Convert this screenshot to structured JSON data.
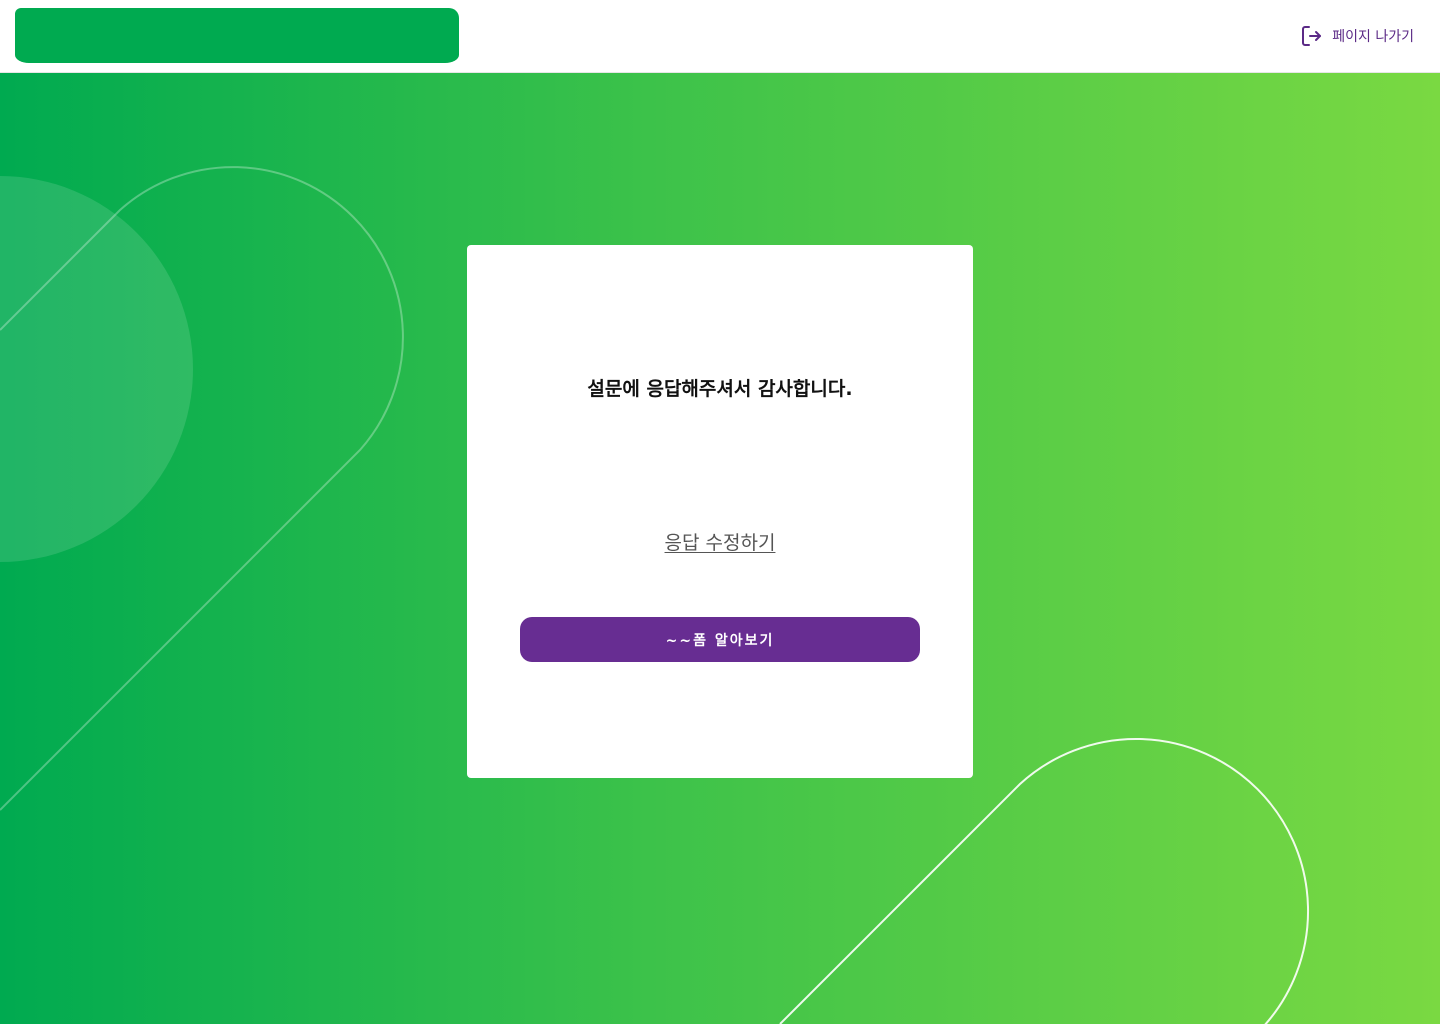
{
  "header": {
    "exit_label": "페이지 나가기",
    "exit_icon": "logout-icon",
    "logo_color": "#00aa50"
  },
  "card": {
    "title": "설문에 응답해주셔서 감사합니다.",
    "edit_link": "응답 수정하기",
    "cta_label": "~~폼 알아보기"
  },
  "colors": {
    "accent": "#672d92",
    "gradient_start": "#00aa50",
    "gradient_end": "#7ad942"
  }
}
